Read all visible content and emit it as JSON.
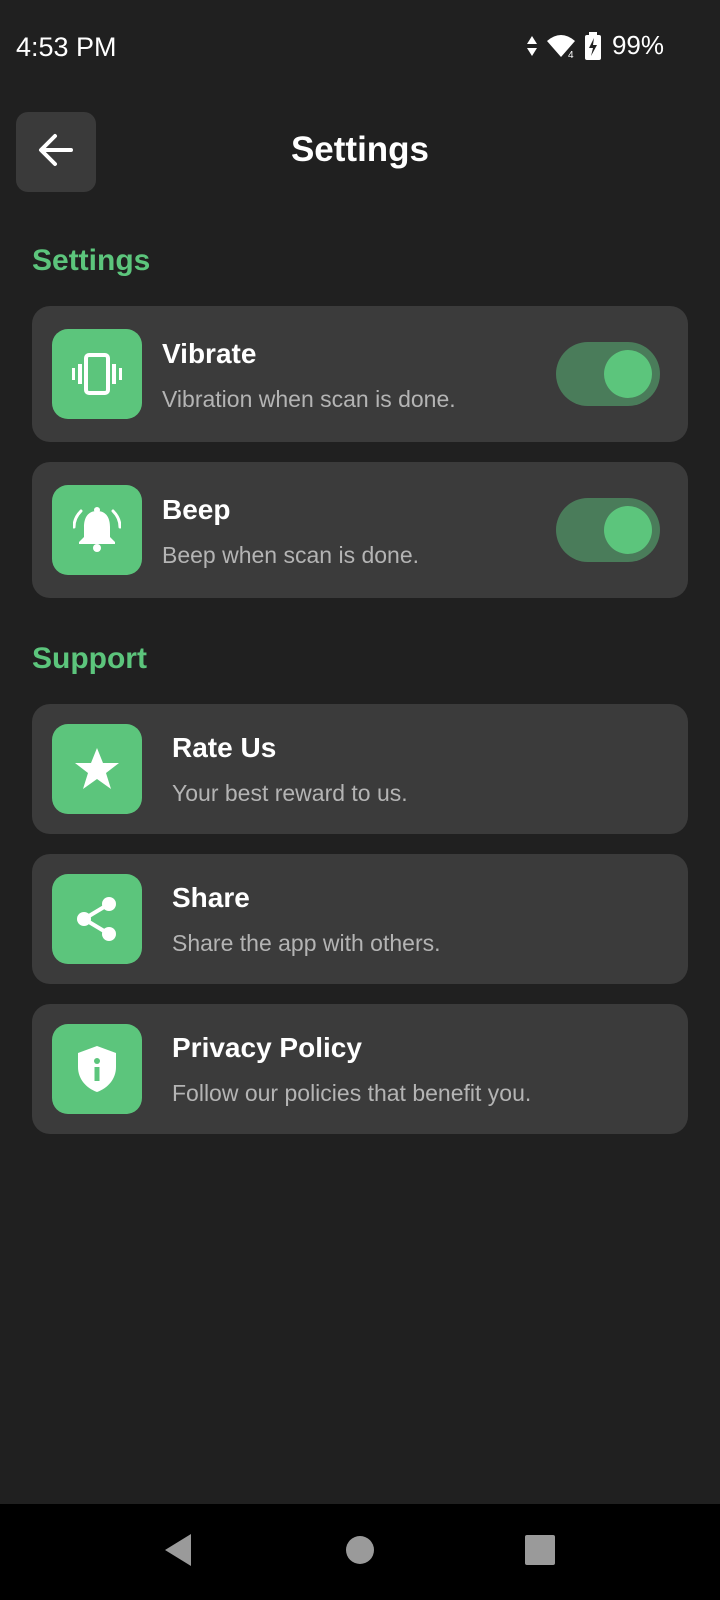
{
  "status_bar": {
    "time": "4:53 PM",
    "battery_percent": "99%",
    "icons": [
      "data-arrows-icon",
      "wifi-icon",
      "battery-charging-icon"
    ]
  },
  "app_bar": {
    "title": "Settings",
    "back_icon": "arrow-left-icon"
  },
  "sections": {
    "settings": {
      "heading": "Settings",
      "items": [
        {
          "title": "Vibrate",
          "subtitle": "Vibration when scan is done.",
          "icon": "vibrate-icon",
          "enabled": true
        },
        {
          "title": "Beep",
          "subtitle": "Beep when scan is done.",
          "icon": "bell-ring-icon",
          "enabled": true
        }
      ]
    },
    "support": {
      "heading": "Support",
      "items": [
        {
          "title": "Rate Us",
          "subtitle": "Your best reward to us.",
          "icon": "star-icon"
        },
        {
          "title": "Share",
          "subtitle": "Share the app with others.",
          "icon": "share-icon"
        },
        {
          "title": "Privacy Policy",
          "subtitle": "Follow our policies that benefit you.",
          "icon": "shield-info-icon"
        }
      ]
    }
  },
  "nav_bar": {
    "buttons": [
      "back-triangle-icon",
      "home-circle-icon",
      "recents-square-icon"
    ]
  },
  "colors": {
    "background": "#202020",
    "card": "#3b3b3b",
    "accent": "#5cc57c",
    "toggle_track": "#4a7c5a",
    "subtitle": "#b4b4b4"
  }
}
